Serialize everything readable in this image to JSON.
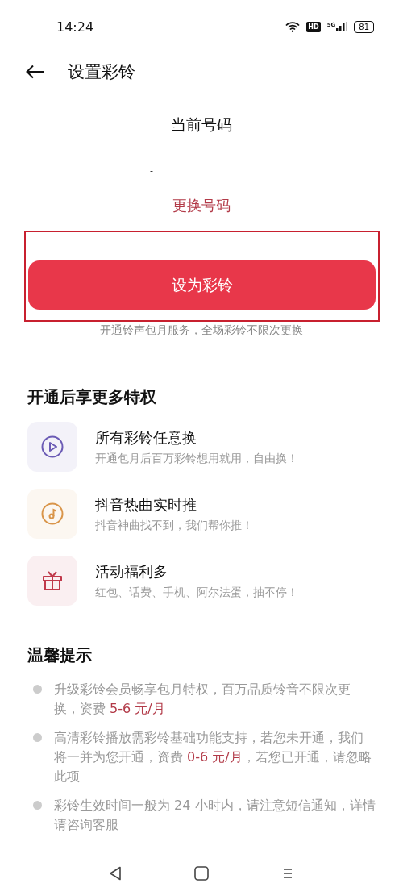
{
  "status_bar": {
    "time": "14:24",
    "hd": "HD",
    "network": "5G",
    "battery": "81"
  },
  "header": {
    "title": "设置彩铃"
  },
  "number": {
    "label": "当前号码",
    "value": "-",
    "change_link": "更换号码"
  },
  "primary_button": {
    "label": "设为彩铃",
    "annotated": true
  },
  "button_note": "开通铃声包月服务，全场彩铃不限次更换",
  "privileges": {
    "title": "开通后享更多特权",
    "items": [
      {
        "kind": "play",
        "color": "#6b5bb5",
        "title": "所有彩铃任意换",
        "subtitle": "开通包月后百万彩铃想用就用，自由换！"
      },
      {
        "kind": "music",
        "color": "#d9954a",
        "title": "抖音热曲实时推",
        "subtitle": "抖音神曲找不到，我们帮你推！"
      },
      {
        "kind": "gift",
        "color": "#c0394b",
        "title": "活动福利多",
        "subtitle": "红包、话费、手机、阿尔法蛋，抽不停！"
      }
    ]
  },
  "tips": {
    "title": "温馨提示",
    "items": [
      {
        "segments": [
          {
            "text": "升级彩铃会员畅享包月特权，百万品质铃音不限次更换，资费 ",
            "highlight": false
          },
          {
            "text": "5-6 元/月",
            "highlight": true
          }
        ]
      },
      {
        "segments": [
          {
            "text": "高清彩铃播放需彩铃基础功能支持，若您未开通，我们将一并为您开通，资费 ",
            "highlight": false
          },
          {
            "text": "0-6 元/月",
            "highlight": true
          },
          {
            "text": "，若您已开通，请忽略此项",
            "highlight": false
          }
        ]
      },
      {
        "segments": [
          {
            "text": "彩铃生效时间一般为 24 小时内，请注意短信通知，详情请咨询客服",
            "highlight": false
          }
        ]
      }
    ]
  }
}
